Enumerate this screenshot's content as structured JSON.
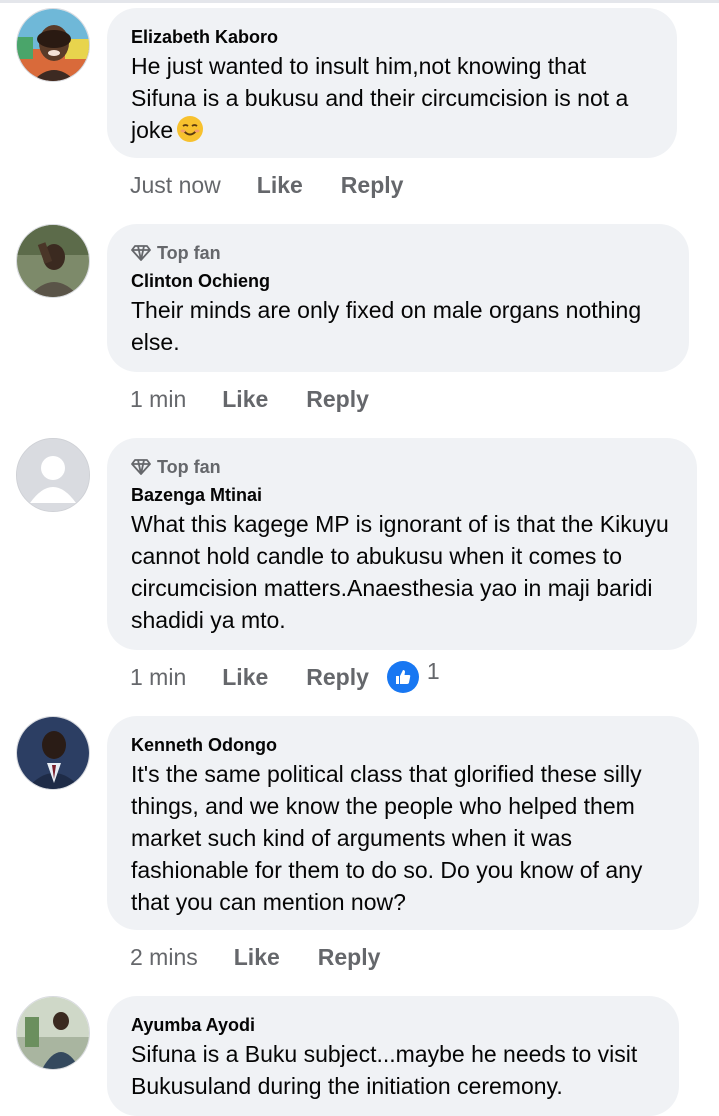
{
  "comments": [
    {
      "name": "Elizabeth Kaboro",
      "badge": "",
      "text": "He just wanted to insult him,not knowing that Sifuna is a bukusu and their circumcision is not a joke",
      "emoji": "smiling-face-emoji",
      "time": "Just now",
      "like": "Like",
      "reply": "Reply"
    },
    {
      "name": "Clinton Ochieng",
      "badge": "Top fan",
      "text": "Their minds are only fixed on male organs nothing else.",
      "time": "1 min",
      "like": "Like",
      "reply": "Reply"
    },
    {
      "name": "Bazenga Mtinai",
      "badge": "Top fan",
      "text": "What this kagege MP is ignorant of is that the Kikuyu cannot hold candle to abukusu when it comes to circumcision matters.Anaesthesia yao in maji baridi shadidi ya mto.",
      "time": "1 min",
      "like": "Like",
      "reply": "Reply",
      "reaction_count": "1"
    },
    {
      "name": "Kenneth Odongo",
      "badge": "",
      "text": "It's the same political class that glorified these silly things, and we know the people who helped them market such kind of arguments when it was fashionable for them to do so. Do you know of any that you can mention now?",
      "time": "2 mins",
      "like": "Like",
      "reply": "Reply"
    },
    {
      "name": "Ayumba Ayodi",
      "badge": "",
      "text": "Sifuna is a Buku subject...maybe he needs to visit Bukusuland during the initiation ceremony."
    }
  ],
  "colors": {
    "bubble": "#f0f2f5",
    "meta_text": "#65676b",
    "like_blue": "#1877f2"
  }
}
